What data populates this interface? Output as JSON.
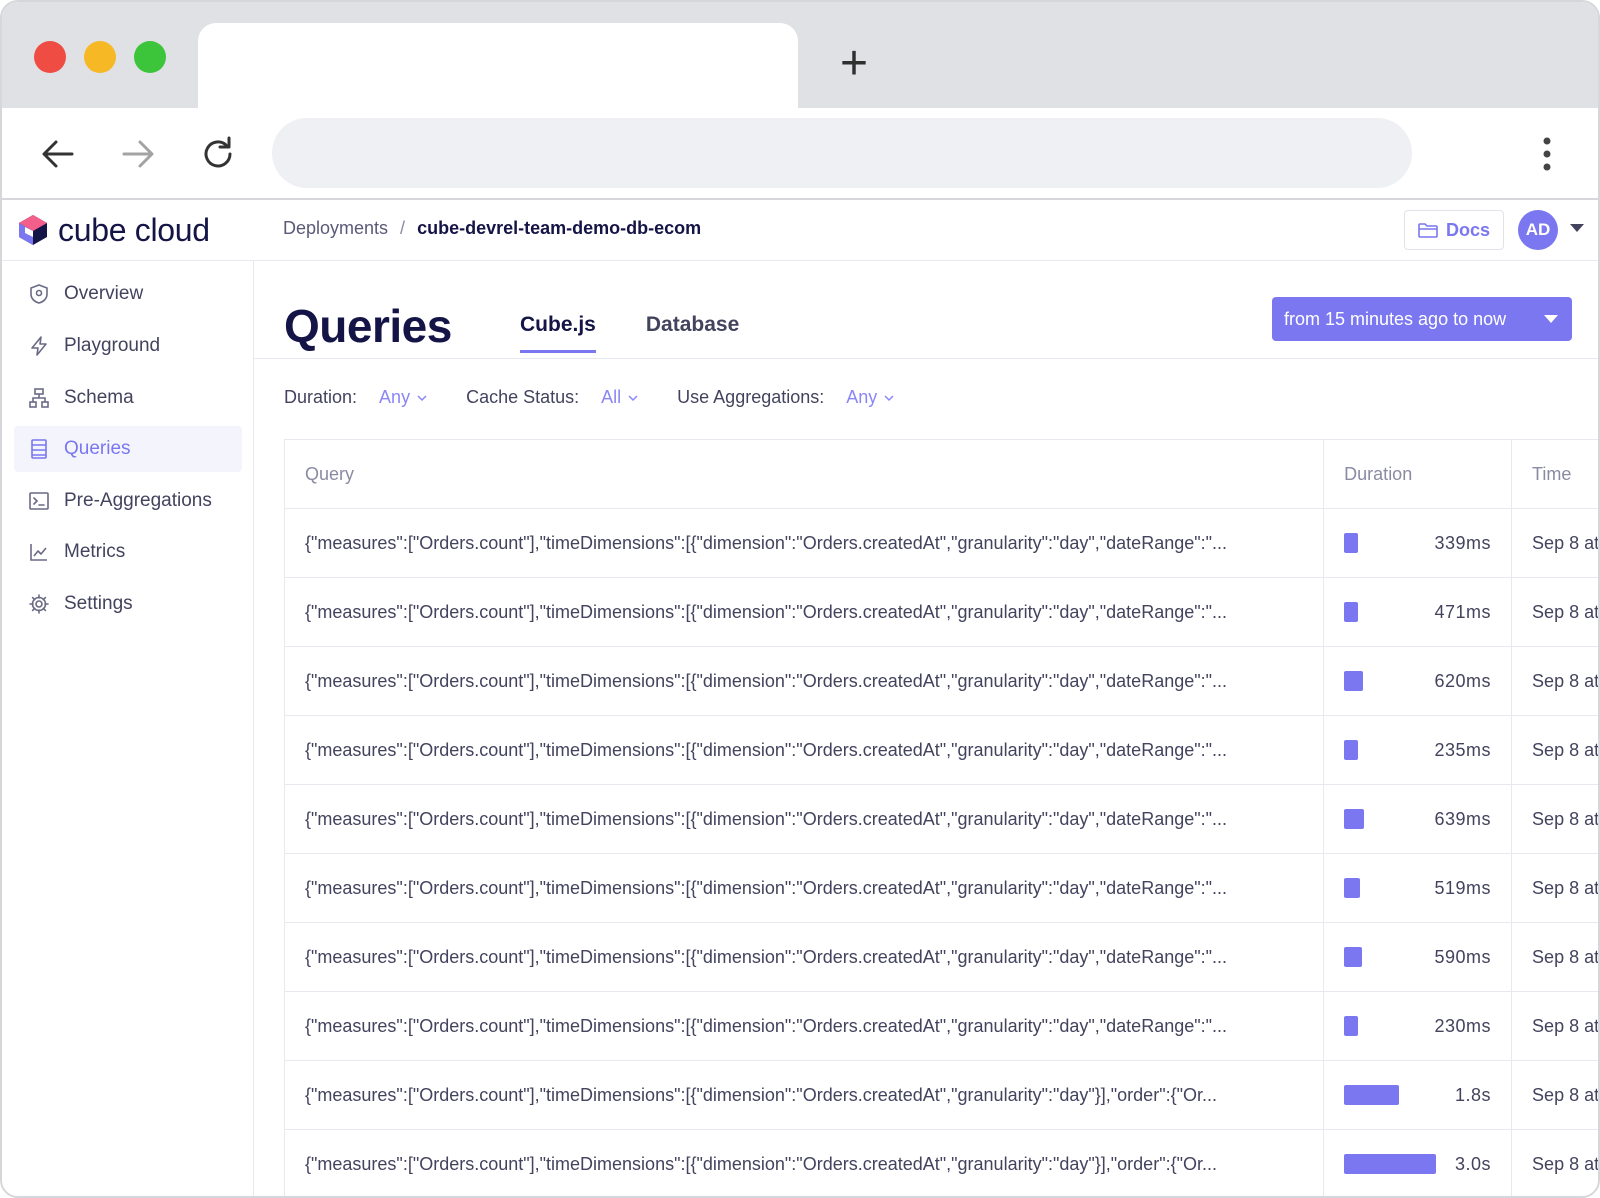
{
  "app": {
    "logo_text": "cube cloud",
    "breadcrumb": {
      "root": "Deployments",
      "separator": "/",
      "current": "cube-devrel-team-demo-db-ecom"
    },
    "docs_label": "Docs",
    "avatar_initials": "AD",
    "brand_color": "#7a77f0"
  },
  "browser": {
    "new_tab_symbol": "+"
  },
  "sidebar": {
    "items": [
      {
        "label": "Overview",
        "icon": "shield-icon",
        "active": false
      },
      {
        "label": "Playground",
        "icon": "bolt-icon",
        "active": false
      },
      {
        "label": "Schema",
        "icon": "schema-icon",
        "active": false
      },
      {
        "label": "Queries",
        "icon": "list-icon",
        "active": true
      },
      {
        "label": "Pre-Aggregations",
        "icon": "terminal-icon",
        "active": false
      },
      {
        "label": "Metrics",
        "icon": "chart-icon",
        "active": false
      },
      {
        "label": "Settings",
        "icon": "gear-icon",
        "active": false
      }
    ]
  },
  "main": {
    "title": "Queries",
    "tabs": [
      {
        "label": "Cube.js",
        "active": true
      },
      {
        "label": "Database",
        "active": false
      }
    ],
    "time_range": "from 15 minutes ago to now",
    "filters": [
      {
        "label": "Duration:",
        "value": "Any"
      },
      {
        "label": "Cache Status:",
        "value": "All"
      },
      {
        "label": "Use Aggregations:",
        "value": "Any"
      }
    ]
  },
  "table": {
    "headers": {
      "query": "Query",
      "duration": "Duration",
      "time": "Time"
    },
    "rows": [
      {
        "query": "{\"measures\":[\"Orders.count\"],\"timeDimensions\":[{\"dimension\":\"Orders.createdAt\",\"granularity\":\"day\",\"dateRange\":\"...",
        "duration": "339ms",
        "duration_ms": 339,
        "time": "Sep 8 at"
      },
      {
        "query": "{\"measures\":[\"Orders.count\"],\"timeDimensions\":[{\"dimension\":\"Orders.createdAt\",\"granularity\":\"day\",\"dateRange\":\"...",
        "duration": "471ms",
        "duration_ms": 471,
        "time": "Sep 8 at"
      },
      {
        "query": "{\"measures\":[\"Orders.count\"],\"timeDimensions\":[{\"dimension\":\"Orders.createdAt\",\"granularity\":\"day\",\"dateRange\":\"...",
        "duration": "620ms",
        "duration_ms": 620,
        "time": "Sep 8 at"
      },
      {
        "query": "{\"measures\":[\"Orders.count\"],\"timeDimensions\":[{\"dimension\":\"Orders.createdAt\",\"granularity\":\"day\",\"dateRange\":\"...",
        "duration": "235ms",
        "duration_ms": 235,
        "time": "Sep 8 at"
      },
      {
        "query": "{\"measures\":[\"Orders.count\"],\"timeDimensions\":[{\"dimension\":\"Orders.createdAt\",\"granularity\":\"day\",\"dateRange\":\"...",
        "duration": "639ms",
        "duration_ms": 639,
        "time": "Sep 8 at"
      },
      {
        "query": "{\"measures\":[\"Orders.count\"],\"timeDimensions\":[{\"dimension\":\"Orders.createdAt\",\"granularity\":\"day\",\"dateRange\":\"...",
        "duration": "519ms",
        "duration_ms": 519,
        "time": "Sep 8 at"
      },
      {
        "query": "{\"measures\":[\"Orders.count\"],\"timeDimensions\":[{\"dimension\":\"Orders.createdAt\",\"granularity\":\"day\",\"dateRange\":\"...",
        "duration": "590ms",
        "duration_ms": 590,
        "time": "Sep 8 at"
      },
      {
        "query": "{\"measures\":[\"Orders.count\"],\"timeDimensions\":[{\"dimension\":\"Orders.createdAt\",\"granularity\":\"day\",\"dateRange\":\"...",
        "duration": "230ms",
        "duration_ms": 230,
        "time": "Sep 8 at"
      },
      {
        "query": "{\"measures\":[\"Orders.count\"],\"timeDimensions\":[{\"dimension\":\"Orders.createdAt\",\"granularity\":\"day\"}],\"order\":{\"Or...",
        "duration": "1.8s",
        "duration_ms": 1800,
        "time": "Sep 8 at"
      },
      {
        "query": "{\"measures\":[\"Orders.count\"],\"timeDimensions\":[{\"dimension\":\"Orders.createdAt\",\"granularity\":\"day\"}],\"order\":{\"Or...",
        "duration": "3.0s",
        "duration_ms": 3000,
        "time": "Sep 8 at"
      }
    ]
  }
}
